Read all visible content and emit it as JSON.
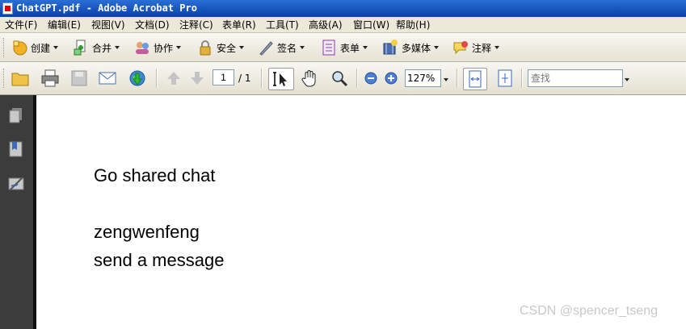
{
  "window": {
    "title": "ChatGPT.pdf - Adobe Acrobat Pro"
  },
  "menu": [
    "文件(F)",
    "编辑(E)",
    "视图(V)",
    "文档(D)",
    "注释(C)",
    "表单(R)",
    "工具(T)",
    "高级(A)",
    "窗口(W)",
    "帮助(H)"
  ],
  "task_toolbar": {
    "create": "创建",
    "combine": "合并",
    "collaborate": "协作",
    "secure": "安全",
    "sign": "签名",
    "forms": "表单",
    "multimedia": "多媒体",
    "comment": "注释"
  },
  "nav_toolbar": {
    "current_page": "1",
    "page_count": "/ 1",
    "zoom": "127%",
    "find_placeholder": "查找"
  },
  "document": {
    "line1": "Go shared chat",
    "line2": "zengwenfeng",
    "line3": "send a message"
  },
  "watermark": "CSDN @spencer_tseng",
  "colors": {
    "titlebar": "#0a3fa8",
    "sidebar": "#3c3c3c",
    "toolbar": "#ece9d8"
  }
}
